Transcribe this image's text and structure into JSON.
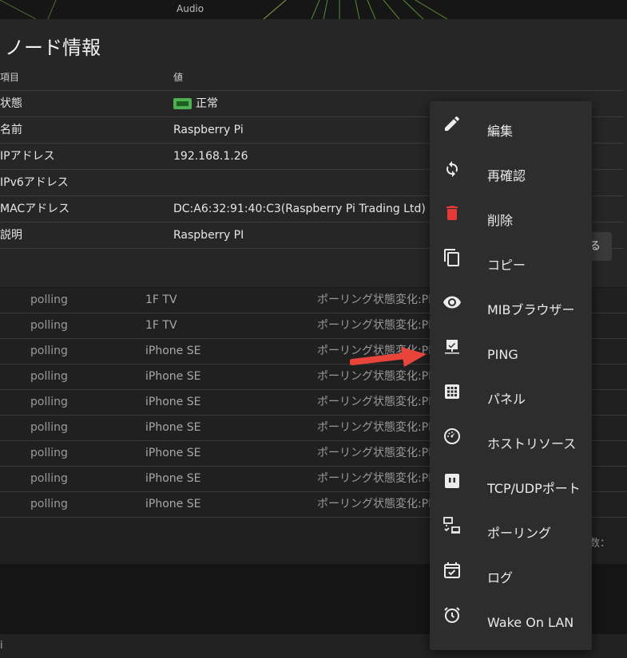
{
  "graph": {
    "label": "Audio"
  },
  "node_info": {
    "title": "ノード情報",
    "columns": {
      "key": "項目",
      "value": "値"
    },
    "rows": [
      {
        "key": "状態",
        "value": "正常",
        "badge": true
      },
      {
        "key": "名前",
        "value": "Raspberry Pi"
      },
      {
        "key": "IPアドレス",
        "value": "192.168.1.26"
      },
      {
        "key": "IPv6アドレス",
        "value": ""
      },
      {
        "key": "MACアドレス",
        "value": "DC:A6:32:91:40:C3(Raspberry Pi Trading Ltd)"
      },
      {
        "key": "説明",
        "value": "Raspberry PI"
      }
    ],
    "close_button_label": "る"
  },
  "log_rows": [
    {
      "type": "polling",
      "node": "1F TV",
      "message": "ポーリング状態変化:PI"
    },
    {
      "type": "polling",
      "node": "1F TV",
      "message": "ポーリング状態変化:PI"
    },
    {
      "type": "polling",
      "node": "iPhone SE",
      "message": "ポーリング状態変化:PI"
    },
    {
      "type": "polling",
      "node": "iPhone SE",
      "message": "ポーリング状態変化:PI"
    },
    {
      "type": "polling",
      "node": "iPhone SE",
      "message": "ポーリング状態変化:PI"
    },
    {
      "type": "polling",
      "node": "iPhone SE",
      "message": "ポーリング状態変化:PI"
    },
    {
      "type": "polling",
      "node": "iPhone SE",
      "message": "ポーリング状態変化:PI"
    },
    {
      "type": "polling",
      "node": "iPhone SE",
      "message": "ポーリング状態変化:PI"
    },
    {
      "type": "polling",
      "node": "iPhone SE",
      "message": "ポーリング状態変化:PI"
    }
  ],
  "pager": {
    "label": "数："
  },
  "bottom": {
    "text": "i"
  },
  "context_menu": {
    "items": [
      {
        "label": "編集",
        "icon": "pencil-icon"
      },
      {
        "label": "再確認",
        "icon": "refresh-icon"
      },
      {
        "label": "削除",
        "icon": "trash-icon"
      },
      {
        "label": "コピー",
        "icon": "copy-icon"
      },
      {
        "label": "MIBブラウザー",
        "icon": "eye-icon"
      },
      {
        "label": "PING",
        "icon": "ping-monitor-icon"
      },
      {
        "label": "パネル",
        "icon": "grid-icon"
      },
      {
        "label": "ホストリソース",
        "icon": "gauge-icon"
      },
      {
        "label": "TCP/UDPポート",
        "icon": "ethernet-port-icon"
      },
      {
        "label": "ポーリング",
        "icon": "polling-monitor-icon"
      },
      {
        "label": "ログ",
        "icon": "calendar-check-icon"
      },
      {
        "label": "Wake On LAN",
        "icon": "alarm-clock-icon"
      }
    ]
  },
  "colors": {
    "accent_green": "#4caf50",
    "delete_red": "#e53935",
    "arrow": "#e8443a"
  }
}
